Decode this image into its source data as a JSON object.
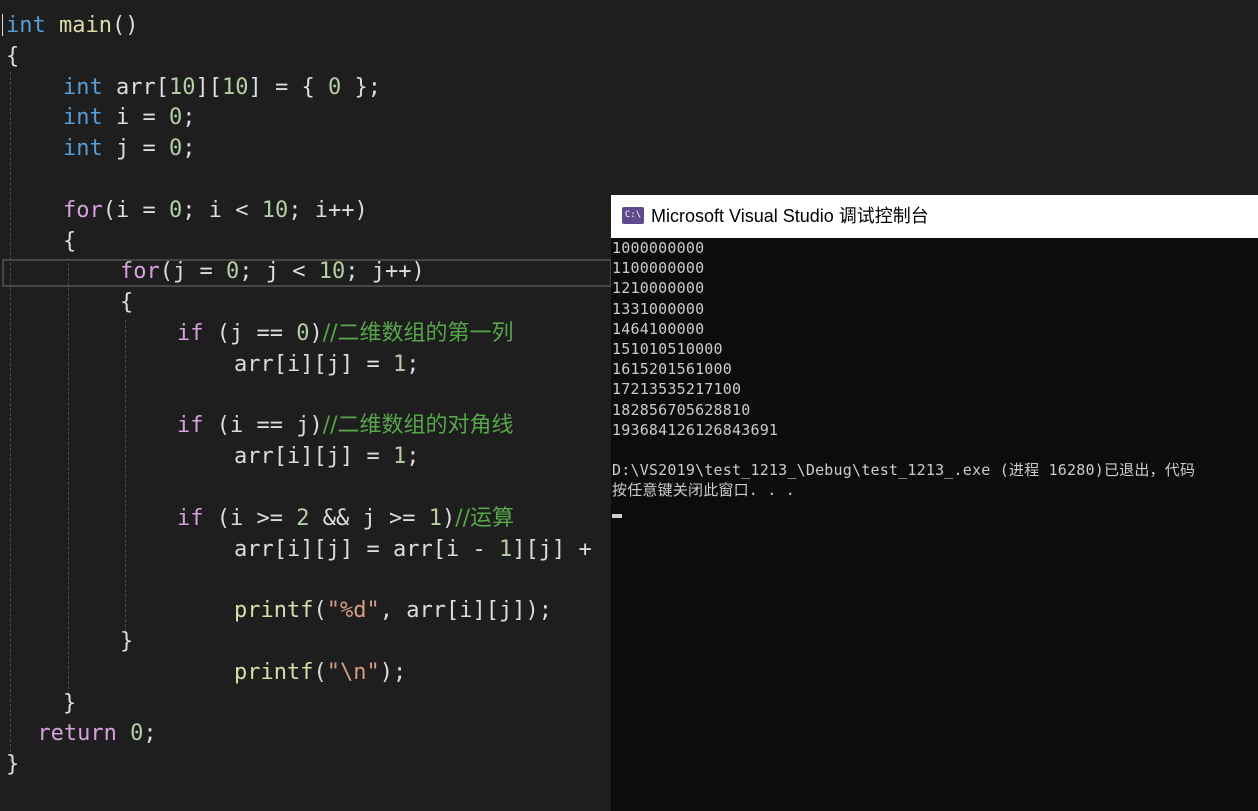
{
  "editor": {
    "lines": [
      {
        "indent": 0,
        "tokens": [
          [
            "keyword",
            "int"
          ],
          [
            "plain",
            " "
          ],
          [
            "func",
            "main"
          ],
          [
            "plain",
            "()"
          ]
        ]
      },
      {
        "indent": 0,
        "tokens": [
          [
            "plain",
            "{"
          ]
        ]
      },
      {
        "indent": 1,
        "tokens": [
          [
            "keyword",
            "int"
          ],
          [
            "plain",
            " "
          ],
          [
            "plain",
            "arr"
          ],
          [
            "plain",
            "["
          ],
          [
            "num",
            "10"
          ],
          [
            "plain",
            "]["
          ],
          [
            "num",
            "10"
          ],
          [
            "plain",
            "] = { "
          ],
          [
            "num",
            "0"
          ],
          [
            "plain",
            " };"
          ]
        ]
      },
      {
        "indent": 1,
        "tokens": [
          [
            "keyword",
            "int"
          ],
          [
            "plain",
            " "
          ],
          [
            "plain",
            "i"
          ],
          [
            "plain",
            " = "
          ],
          [
            "num",
            "0"
          ],
          [
            "plain",
            ";"
          ]
        ]
      },
      {
        "indent": 1,
        "tokens": [
          [
            "keyword",
            "int"
          ],
          [
            "plain",
            " "
          ],
          [
            "plain",
            "j"
          ],
          [
            "plain",
            " = "
          ],
          [
            "num",
            "0"
          ],
          [
            "plain",
            ";"
          ]
        ]
      },
      {
        "indent": 1,
        "tokens": []
      },
      {
        "indent": 1,
        "tokens": [
          [
            "flow",
            "for"
          ],
          [
            "plain",
            "("
          ],
          [
            "plain",
            "i"
          ],
          [
            "plain",
            " = "
          ],
          [
            "num",
            "0"
          ],
          [
            "plain",
            "; "
          ],
          [
            "plain",
            "i"
          ],
          [
            "plain",
            " < "
          ],
          [
            "num",
            "10"
          ],
          [
            "plain",
            "; "
          ],
          [
            "plain",
            "i"
          ],
          [
            "plain",
            "++)"
          ]
        ]
      },
      {
        "indent": 1,
        "tokens": [
          [
            "plain",
            "{"
          ]
        ]
      },
      {
        "indent": 2,
        "tokens": [
          [
            "flow",
            "for"
          ],
          [
            "plain",
            "("
          ],
          [
            "plain",
            "j"
          ],
          [
            "plain",
            " = "
          ],
          [
            "num",
            "0"
          ],
          [
            "plain",
            "; "
          ],
          [
            "plain",
            "j"
          ],
          [
            "plain",
            " < "
          ],
          [
            "num",
            "10"
          ],
          [
            "plain",
            "; "
          ],
          [
            "plain",
            "j"
          ],
          [
            "plain",
            "++)"
          ]
        ]
      },
      {
        "indent": 2,
        "tokens": [
          [
            "plain",
            "{"
          ]
        ]
      },
      {
        "indent": 3,
        "tokens": [
          [
            "flow",
            "if"
          ],
          [
            "plain",
            " ("
          ],
          [
            "plain",
            "j"
          ],
          [
            "plain",
            " == "
          ],
          [
            "num",
            "0"
          ],
          [
            "plain",
            ")"
          ],
          [
            "comment",
            "//二维数组的第一列"
          ]
        ]
      },
      {
        "indent": 4,
        "tokens": [
          [
            "plain",
            "arr"
          ],
          [
            "plain",
            "["
          ],
          [
            "plain",
            "i"
          ],
          [
            "plain",
            "]["
          ],
          [
            "plain",
            "j"
          ],
          [
            "plain",
            "] = "
          ],
          [
            "num",
            "1"
          ],
          [
            "plain",
            ";"
          ]
        ]
      },
      {
        "indent": 3,
        "tokens": []
      },
      {
        "indent": 3,
        "tokens": [
          [
            "flow",
            "if"
          ],
          [
            "plain",
            " ("
          ],
          [
            "plain",
            "i"
          ],
          [
            "plain",
            " == "
          ],
          [
            "plain",
            "j"
          ],
          [
            "plain",
            ")"
          ],
          [
            "comment",
            "//二维数组的对角线"
          ]
        ]
      },
      {
        "indent": 4,
        "tokens": [
          [
            "plain",
            "arr"
          ],
          [
            "plain",
            "["
          ],
          [
            "plain",
            "i"
          ],
          [
            "plain",
            "]["
          ],
          [
            "plain",
            "j"
          ],
          [
            "plain",
            "] = "
          ],
          [
            "num",
            "1"
          ],
          [
            "plain",
            ";"
          ]
        ]
      },
      {
        "indent": 3,
        "tokens": []
      },
      {
        "indent": 3,
        "tokens": [
          [
            "flow",
            "if"
          ],
          [
            "plain",
            " ("
          ],
          [
            "plain",
            "i"
          ],
          [
            "plain",
            " >= "
          ],
          [
            "num",
            "2"
          ],
          [
            "plain",
            " && "
          ],
          [
            "plain",
            "j"
          ],
          [
            "plain",
            " >= "
          ],
          [
            "num",
            "1"
          ],
          [
            "plain",
            ")"
          ],
          [
            "comment",
            "//运算"
          ]
        ]
      },
      {
        "indent": 4,
        "tokens": [
          [
            "plain",
            "arr"
          ],
          [
            "plain",
            "["
          ],
          [
            "plain",
            "i"
          ],
          [
            "plain",
            "]["
          ],
          [
            "plain",
            "j"
          ],
          [
            "plain",
            "] = "
          ],
          [
            "plain",
            "arr"
          ],
          [
            "plain",
            "["
          ],
          [
            "plain",
            "i"
          ],
          [
            "plain",
            " - "
          ],
          [
            "num",
            "1"
          ],
          [
            "plain",
            "]["
          ],
          [
            "plain",
            "j"
          ],
          [
            "plain",
            "] +"
          ]
        ]
      },
      {
        "indent": 4,
        "tokens": []
      },
      {
        "indent": 4,
        "tokens": [
          [
            "func",
            "printf"
          ],
          [
            "plain",
            "("
          ],
          [
            "str",
            "\"%d\""
          ],
          [
            "plain",
            ", "
          ],
          [
            "plain",
            "arr"
          ],
          [
            "plain",
            "["
          ],
          [
            "plain",
            "i"
          ],
          [
            "plain",
            "]["
          ],
          [
            "plain",
            "j"
          ],
          [
            "plain",
            "]);"
          ]
        ]
      },
      {
        "indent": 2,
        "tokens": [
          [
            "plain",
            "}"
          ]
        ]
      },
      {
        "indent": 4,
        "tokens": [
          [
            "func",
            "printf"
          ],
          [
            "plain",
            "("
          ],
          [
            "str",
            "\"\\n\""
          ],
          [
            "plain",
            ");"
          ]
        ]
      },
      {
        "indent": 1,
        "tokens": [
          [
            "plain",
            "}"
          ]
        ]
      },
      {
        "indent": 0.55,
        "tokens": [
          [
            "flow",
            "return"
          ],
          [
            "plain",
            " "
          ],
          [
            "num",
            "0"
          ],
          [
            "plain",
            ";"
          ]
        ]
      },
      {
        "indent": 0,
        "tokens": [
          [
            "plain",
            "}"
          ]
        ]
      }
    ]
  },
  "console": {
    "title": "Microsoft Visual Studio 调试控制台",
    "icon": "console-app-icon",
    "icon_text": "C:\\",
    "output": [
      "1000000000",
      "1100000000",
      "1210000000",
      "1331000000",
      "1464100000",
      "151010510000",
      "1615201561000",
      "17213535217100",
      "182856705628810",
      "193684126126843691",
      "",
      "D:\\VS2019\\test_1213_\\Debug\\test_1213_.exe (进程 16280)已退出，代码",
      "按任意键关闭此窗口. . ."
    ]
  },
  "colors": {
    "editor_bg": "#1e1e1e",
    "keyword": "#569cd6",
    "flow_keyword": "#d8a0df",
    "function": "#dcdcaa",
    "number": "#b5cea8",
    "string": "#d69d85",
    "comment": "#57a64a",
    "console_bg": "#0c0c0c",
    "console_text": "#cccccc"
  }
}
